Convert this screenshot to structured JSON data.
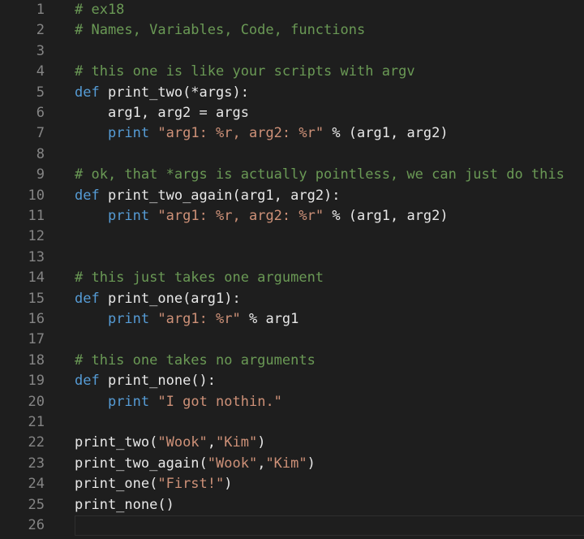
{
  "editor": {
    "colors": {
      "background": "#1e1e1e",
      "line_number": "#858585",
      "comment": "#6a9955",
      "keyword": "#569cd6",
      "string": "#ce9178",
      "plain": "#e8e8e8"
    },
    "current_line": 26,
    "lines": [
      {
        "n": "1",
        "tokens": [
          {
            "t": "comment",
            "v": "# ex18"
          }
        ]
      },
      {
        "n": "2",
        "tokens": [
          {
            "t": "comment",
            "v": "# Names, Variables, Code, functions"
          }
        ]
      },
      {
        "n": "3",
        "tokens": []
      },
      {
        "n": "4",
        "tokens": [
          {
            "t": "comment",
            "v": "# this one is like your scripts with argv"
          }
        ]
      },
      {
        "n": "5",
        "tokens": [
          {
            "t": "keyword",
            "v": "def"
          },
          {
            "t": "plain",
            "v": " print_two(*args):"
          }
        ]
      },
      {
        "n": "6",
        "tokens": [
          {
            "t": "plain",
            "v": "    arg1, arg2 = args"
          }
        ]
      },
      {
        "n": "7",
        "tokens": [
          {
            "t": "plain",
            "v": "    "
          },
          {
            "t": "keyword",
            "v": "print"
          },
          {
            "t": "plain",
            "v": " "
          },
          {
            "t": "string",
            "v": "\"arg1: %r, arg2: %r\""
          },
          {
            "t": "plain",
            "v": " % (arg1, arg2)"
          }
        ]
      },
      {
        "n": "8",
        "tokens": []
      },
      {
        "n": "9",
        "tokens": [
          {
            "t": "comment",
            "v": "# ok, that *args is actually pointless, we can just do this"
          }
        ]
      },
      {
        "n": "10",
        "tokens": [
          {
            "t": "keyword",
            "v": "def"
          },
          {
            "t": "plain",
            "v": " print_two_again(arg1, arg2):"
          }
        ]
      },
      {
        "n": "11",
        "tokens": [
          {
            "t": "plain",
            "v": "    "
          },
          {
            "t": "keyword",
            "v": "print"
          },
          {
            "t": "plain",
            "v": " "
          },
          {
            "t": "string",
            "v": "\"arg1: %r, arg2: %r\""
          },
          {
            "t": "plain",
            "v": " % (arg1, arg2)"
          }
        ]
      },
      {
        "n": "12",
        "tokens": []
      },
      {
        "n": "13",
        "tokens": []
      },
      {
        "n": "14",
        "tokens": [
          {
            "t": "comment",
            "v": "# this just takes one argument"
          }
        ]
      },
      {
        "n": "15",
        "tokens": [
          {
            "t": "keyword",
            "v": "def"
          },
          {
            "t": "plain",
            "v": " print_one(arg1):"
          }
        ]
      },
      {
        "n": "16",
        "tokens": [
          {
            "t": "plain",
            "v": "    "
          },
          {
            "t": "keyword",
            "v": "print"
          },
          {
            "t": "plain",
            "v": " "
          },
          {
            "t": "string",
            "v": "\"arg1: %r\""
          },
          {
            "t": "plain",
            "v": " % arg1"
          }
        ]
      },
      {
        "n": "17",
        "tokens": []
      },
      {
        "n": "18",
        "tokens": [
          {
            "t": "comment",
            "v": "# this one takes no arguments"
          }
        ]
      },
      {
        "n": "19",
        "tokens": [
          {
            "t": "keyword",
            "v": "def"
          },
          {
            "t": "plain",
            "v": " print_none():"
          }
        ]
      },
      {
        "n": "20",
        "tokens": [
          {
            "t": "plain",
            "v": "    "
          },
          {
            "t": "keyword",
            "v": "print"
          },
          {
            "t": "plain",
            "v": " "
          },
          {
            "t": "string",
            "v": "\"I got nothin.\""
          }
        ]
      },
      {
        "n": "21",
        "tokens": []
      },
      {
        "n": "22",
        "tokens": [
          {
            "t": "plain",
            "v": "print_two("
          },
          {
            "t": "string",
            "v": "\"Wook\""
          },
          {
            "t": "plain",
            "v": ","
          },
          {
            "t": "string",
            "v": "\"Kim\""
          },
          {
            "t": "plain",
            "v": ")"
          }
        ]
      },
      {
        "n": "23",
        "tokens": [
          {
            "t": "plain",
            "v": "print_two_again("
          },
          {
            "t": "string",
            "v": "\"Wook\""
          },
          {
            "t": "plain",
            "v": ","
          },
          {
            "t": "string",
            "v": "\"Kim\""
          },
          {
            "t": "plain",
            "v": ")"
          }
        ]
      },
      {
        "n": "24",
        "tokens": [
          {
            "t": "plain",
            "v": "print_one("
          },
          {
            "t": "string",
            "v": "\"First!\""
          },
          {
            "t": "plain",
            "v": ")"
          }
        ]
      },
      {
        "n": "25",
        "tokens": [
          {
            "t": "plain",
            "v": "print_none()"
          }
        ]
      },
      {
        "n": "26",
        "tokens": []
      }
    ]
  }
}
